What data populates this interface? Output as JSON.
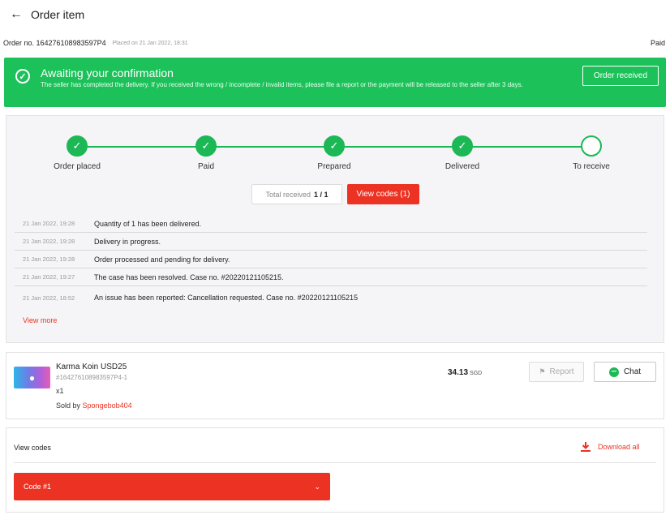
{
  "header": {
    "back_icon": "arrow-left-icon",
    "title": "Order item"
  },
  "order": {
    "number_label": "Order no. 164276108983597P4",
    "placed_on": "Placed on 21 Jan 2022, 18:31",
    "status": "Paid"
  },
  "banner": {
    "color": "#1cc15a",
    "icon": "check-circle-icon",
    "title": "Awaiting your confirmation",
    "description": "The seller has completed the delivery. If you received the wrong / incomplete / invalid items, please file a report or the payment will be released to the seller after 3 days.",
    "button_label": "Order received"
  },
  "tracker": {
    "steps": [
      {
        "label": "Order placed",
        "done": true
      },
      {
        "label": "Paid",
        "done": true
      },
      {
        "label": "Prepared",
        "done": true
      },
      {
        "label": "Delivered",
        "done": true
      },
      {
        "label": "To receive",
        "done": false
      }
    ],
    "total_received_label": "Total received",
    "total_received_value": "1 / 1",
    "view_codes_label": "View codes (1)",
    "timeline": [
      {
        "time": "21 Jan 2022, 19:28",
        "text": "Quantity of 1 has been delivered."
      },
      {
        "time": "21 Jan 2022, 19:28",
        "text": "Delivery in progress."
      },
      {
        "time": "21 Jan 2022, 19:28",
        "text": "Order processed and pending for delivery."
      },
      {
        "time": "21 Jan 2022, 19:27",
        "text": "The case has been resolved. Case no. #20220121105215."
      },
      {
        "time": "21 Jan 2022, 18:52",
        "text": "An issue has been reported: Cancellation requested. Case no. #20220121105215"
      }
    ],
    "view_more_label": "View more"
  },
  "product": {
    "name": "Karma Koin USD25",
    "sku": "#164276108983597P4-1",
    "quantity": "x1",
    "sold_by_label": "Sold by",
    "seller": "Spongebob404",
    "price": "34.13",
    "currency": "SGD",
    "report_label": "Report",
    "chat_label": "Chat"
  },
  "codes": {
    "title": "View codes",
    "download_all_label": "Download all",
    "items": [
      {
        "label": "Code #1"
      }
    ]
  },
  "colors": {
    "accent": "#ec3323",
    "success": "#1cb855"
  }
}
